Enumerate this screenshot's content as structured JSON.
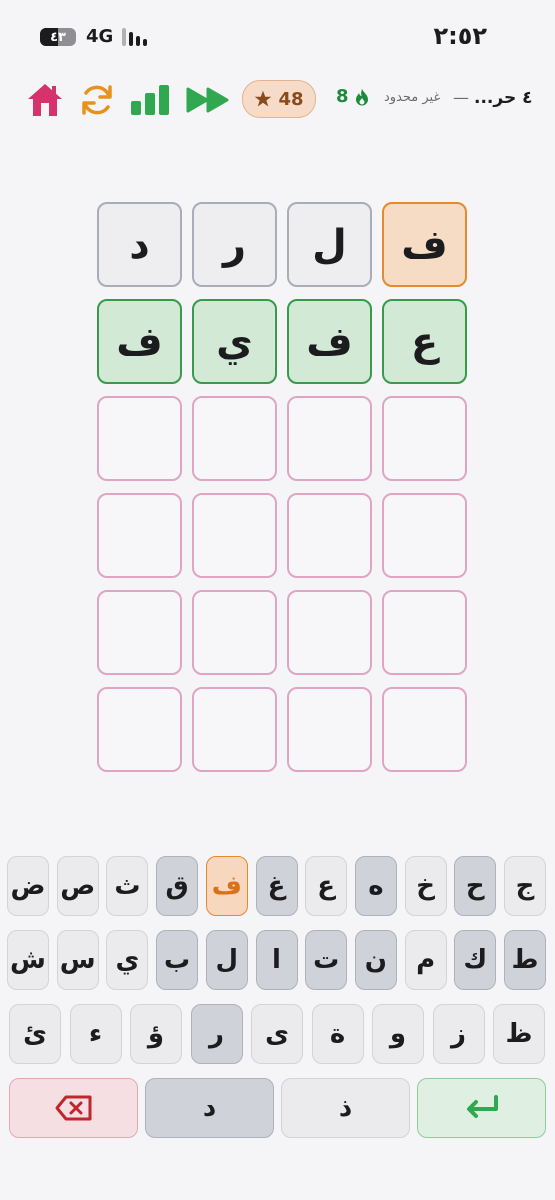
{
  "status_bar": {
    "time": "٢:٥٢",
    "battery": "٤٣",
    "network": "4G"
  },
  "header": {
    "title": "٤ حر...",
    "separator": "—",
    "mode": "غير محدود",
    "streak": "8",
    "score": "48",
    "icons": [
      "home-icon",
      "refresh-icon",
      "stats-icon",
      "skip-icon",
      "star-icon",
      "flame-icon"
    ],
    "colors": {
      "home": "#d6336c",
      "refresh": "#e8921e",
      "green": "#2fa84f",
      "score_bg": "#f6dcc8"
    }
  },
  "grid": {
    "rows": [
      [
        {
          "letter": "ف",
          "state": "present"
        },
        {
          "letter": "ل",
          "state": "absent"
        },
        {
          "letter": "ر",
          "state": "absent"
        },
        {
          "letter": "د",
          "state": "absent"
        }
      ],
      [
        {
          "letter": "ع",
          "state": "correct"
        },
        {
          "letter": "ف",
          "state": "correct"
        },
        {
          "letter": "ي",
          "state": "correct"
        },
        {
          "letter": "ف",
          "state": "correct"
        }
      ],
      [
        {
          "letter": "",
          "state": "empty"
        },
        {
          "letter": "",
          "state": "empty"
        },
        {
          "letter": "",
          "state": "empty"
        },
        {
          "letter": "",
          "state": "empty"
        }
      ],
      [
        {
          "letter": "",
          "state": "empty"
        },
        {
          "letter": "",
          "state": "empty"
        },
        {
          "letter": "",
          "state": "empty"
        },
        {
          "letter": "",
          "state": "empty"
        }
      ],
      [
        {
          "letter": "",
          "state": "empty"
        },
        {
          "letter": "",
          "state": "empty"
        },
        {
          "letter": "",
          "state": "empty"
        },
        {
          "letter": "",
          "state": "empty"
        }
      ],
      [
        {
          "letter": "",
          "state": "empty"
        },
        {
          "letter": "",
          "state": "empty"
        },
        {
          "letter": "",
          "state": "empty"
        },
        {
          "letter": "",
          "state": "empty"
        }
      ]
    ]
  },
  "keyboard": {
    "row1": [
      {
        "k": "ج",
        "s": ""
      },
      {
        "k": "ح",
        "s": "absent"
      },
      {
        "k": "خ",
        "s": ""
      },
      {
        "k": "ه",
        "s": "absent"
      },
      {
        "k": "ع",
        "s": ""
      },
      {
        "k": "غ",
        "s": "absent"
      },
      {
        "k": "ف",
        "s": "present"
      },
      {
        "k": "ق",
        "s": "absent"
      },
      {
        "k": "ث",
        "s": ""
      },
      {
        "k": "ص",
        "s": ""
      },
      {
        "k": "ض",
        "s": ""
      }
    ],
    "row2": [
      {
        "k": "ط",
        "s": "absent"
      },
      {
        "k": "ك",
        "s": "absent"
      },
      {
        "k": "م",
        "s": ""
      },
      {
        "k": "ن",
        "s": "absent"
      },
      {
        "k": "ت",
        "s": "absent"
      },
      {
        "k": "ا",
        "s": "absent"
      },
      {
        "k": "ل",
        "s": "absent"
      },
      {
        "k": "ب",
        "s": "absent"
      },
      {
        "k": "ي",
        "s": ""
      },
      {
        "k": "س",
        "s": ""
      },
      {
        "k": "ش",
        "s": ""
      }
    ],
    "row3": [
      {
        "k": "ظ",
        "s": ""
      },
      {
        "k": "ز",
        "s": ""
      },
      {
        "k": "و",
        "s": ""
      },
      {
        "k": "ة",
        "s": ""
      },
      {
        "k": "ى",
        "s": ""
      },
      {
        "k": "ر",
        "s": "absent"
      },
      {
        "k": "ؤ",
        "s": ""
      },
      {
        "k": "ء",
        "s": ""
      },
      {
        "k": "ئ",
        "s": ""
      }
    ],
    "row4": {
      "enter": "enter-icon",
      "dhal": "ذ",
      "dal": "د",
      "delete": "backspace-icon"
    }
  }
}
